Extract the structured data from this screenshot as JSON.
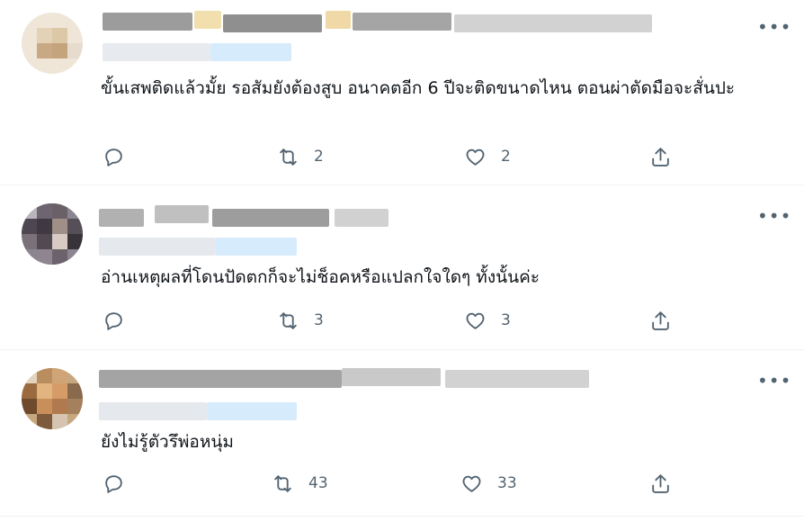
{
  "colors": {
    "text": "#0f1419",
    "secondary": "#536471",
    "divider": "#eff3f4",
    "link_blur": "#d6ebfb"
  },
  "icons": {
    "more": "more-horizontal-icon",
    "reply": "reply-icon",
    "retweet": "retweet-icon",
    "like": "heart-icon",
    "share": "share-icon"
  },
  "tweets": [
    {
      "more": "•••",
      "text": "ขั้นเสพติดแล้วมั้ย รอสัมยังต้องสูบ อนาคตอีก 6 ปีจะติดขนาดไหน ตอนผ่าตัดมือจะสั่นปะ",
      "retweets": "2",
      "likes": "2"
    },
    {
      "more": "•••",
      "text": "อ่านเหตุผลที่โดนปัดตกก็จะไม่ช็อคหรือแปลกใจใดๆ ทั้งนั้นค่ะ",
      "retweets": "3",
      "likes": "3"
    },
    {
      "more": "•••",
      "text": "ยังไม่รู้ตัวรึพ่อหนุ่ม",
      "retweets": "43",
      "likes": "33"
    }
  ]
}
